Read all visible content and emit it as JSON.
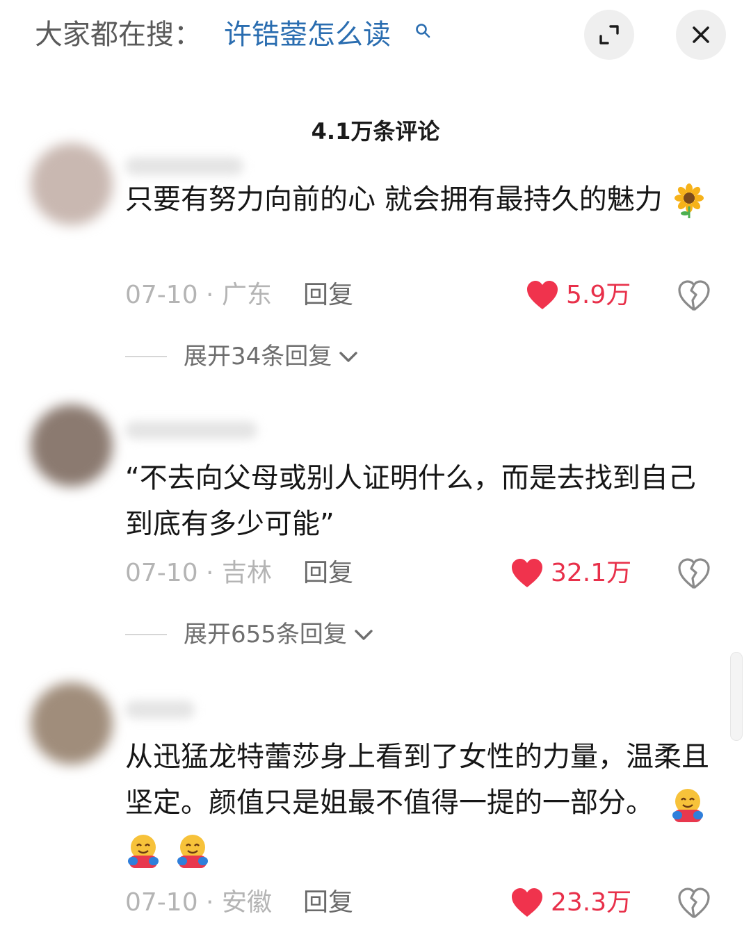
{
  "search": {
    "prefix": "大家都在搜：",
    "term": "许锆蓥怎么读"
  },
  "header": {
    "title": "4.1万条评论"
  },
  "comments": [
    {
      "text": "只要有努力向前的心 就会拥有最持久的魅力",
      "emoji": "sunflower",
      "meta": "07-10 · 广东",
      "reply_label": "回复",
      "likes": "5.9万",
      "expand_label": "展开34条回复"
    },
    {
      "text": "“不去向父母或别人证明什么，而是去找到自己到底有多少可能”",
      "meta": "07-10 · 吉林",
      "reply_label": "回复",
      "likes": "32.1万",
      "expand_label": "展开655条回复"
    },
    {
      "text": "从迅猛龙特蕾莎身上看到了女性的力量，温柔且坚定。颜值只是姐最不值得一提的一部分。",
      "emoji": "hugging-face x3",
      "meta": "07-10 · 安徽",
      "reply_label": "回复",
      "likes": "23.3万"
    }
  ],
  "colors": {
    "accent_link": "#2a6db0",
    "like_red": "#e8304a",
    "muted": "#b4b4b4"
  }
}
